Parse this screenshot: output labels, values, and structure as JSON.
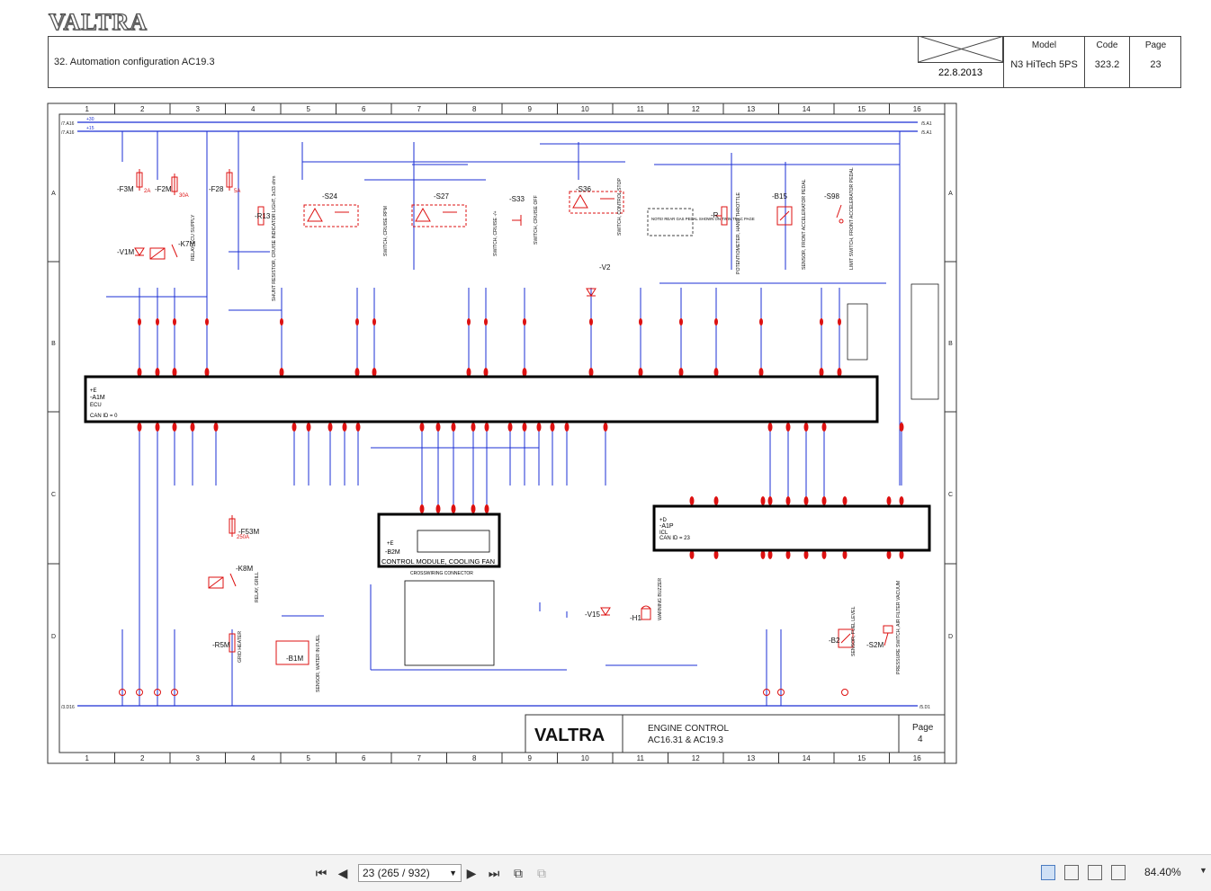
{
  "doc": {
    "logo": "VALTRA",
    "title": "32. Automation configuration AC19.3",
    "date": "22.8.2013",
    "model_label": "Model",
    "model_value": "N3 HiTech 5PS",
    "code_label": "Code",
    "code_value": "323.2",
    "page_label": "Page",
    "page_value": "23"
  },
  "grid": {
    "columns": [
      "1",
      "2",
      "3",
      "4",
      "5",
      "6",
      "7",
      "8",
      "9",
      "10",
      "11",
      "12",
      "13",
      "14",
      "15",
      "16"
    ],
    "rows": [
      "A",
      "B",
      "C",
      "D"
    ]
  },
  "schematic": {
    "components": [
      {
        "id": "-F3M",
        "sub": "2A"
      },
      {
        "id": "-F2M",
        "sub": "30A"
      },
      {
        "id": "-F28",
        "sub": "5A"
      },
      {
        "id": "-V1M"
      },
      {
        "id": "-K7M",
        "desc": "RELAY, ECU SUPPLY"
      },
      {
        "id": "-R13",
        "desc": "SHUNT RESISTOR, CRUISE INDICATOR LIGHT, 3x33 ohm"
      },
      {
        "id": "-S24",
        "desc": "SWITCH, CRUISE RPM"
      },
      {
        "id": "-S27",
        "desc": "SWITCH, CRUISE -/+"
      },
      {
        "id": "-S33",
        "desc": "SWITCH, CRUISE OFF"
      },
      {
        "id": "-S36",
        "desc": "SWITCH, CONTROL STOP"
      },
      {
        "id": "-V2"
      },
      {
        "id": "-R",
        "desc": "POTENTIOMETER, HAND THROTTLE"
      },
      {
        "id": "-B15",
        "desc": "SENSOR, FRONT ACCELERATOR PEDAL"
      },
      {
        "id": "-S98",
        "desc": "LIMIT SWITCH, FRONT ACCELERATOR PEDAL"
      },
      {
        "id": "-F53M",
        "sub": "250A"
      },
      {
        "id": "-K8M",
        "desc": "RELAY, GRILL"
      },
      {
        "id": "-R5M",
        "desc": "GRID HEATER"
      },
      {
        "id": "-B1M",
        "desc": "SENSOR, WATER IN FUEL"
      },
      {
        "id": "-B2M",
        "desc": "CONTROL MODULE, COOLING FAN"
      },
      {
        "id": "-V15"
      },
      {
        "id": "-H1",
        "desc": "WARNING BUZZER"
      },
      {
        "id": "-B2",
        "desc": "SENSOR, FUEL LEVEL"
      },
      {
        "id": "-S2M",
        "desc": "PRESSURE SWITCH, AIR FILTER VACUUM"
      }
    ],
    "ecu_labels": [
      "+E",
      "-A1M",
      "ECU",
      "CAN ID = 0"
    ],
    "module_labels": [
      "+D",
      "-A1P",
      "ICL",
      "CAN ID = 23"
    ],
    "crosswiring_label": "CROSSWIRING CONNECTOR",
    "bus_left": [
      "/7.A16",
      "/7.A16"
    ],
    "bus_right": [
      "/5.A1",
      "/5.A1"
    ],
    "bus_volts": [
      "+30",
      "+15"
    ],
    "ground_left": "/3.D16",
    "ground_right": "/5.D1",
    "note": "NOTE! REAR GAS PEDAL SHOWN ON TWIN TRAC PAGE",
    "footer_brand": "VALTRA",
    "footer_title_1": "ENGINE CONTROL",
    "footer_title_2": "AC16.31 & AC19.3",
    "footer_page_label": "Page",
    "footer_page_value": "4"
  },
  "viewer": {
    "page_field": "23 (265 / 932)",
    "zoom": "84.40%"
  }
}
